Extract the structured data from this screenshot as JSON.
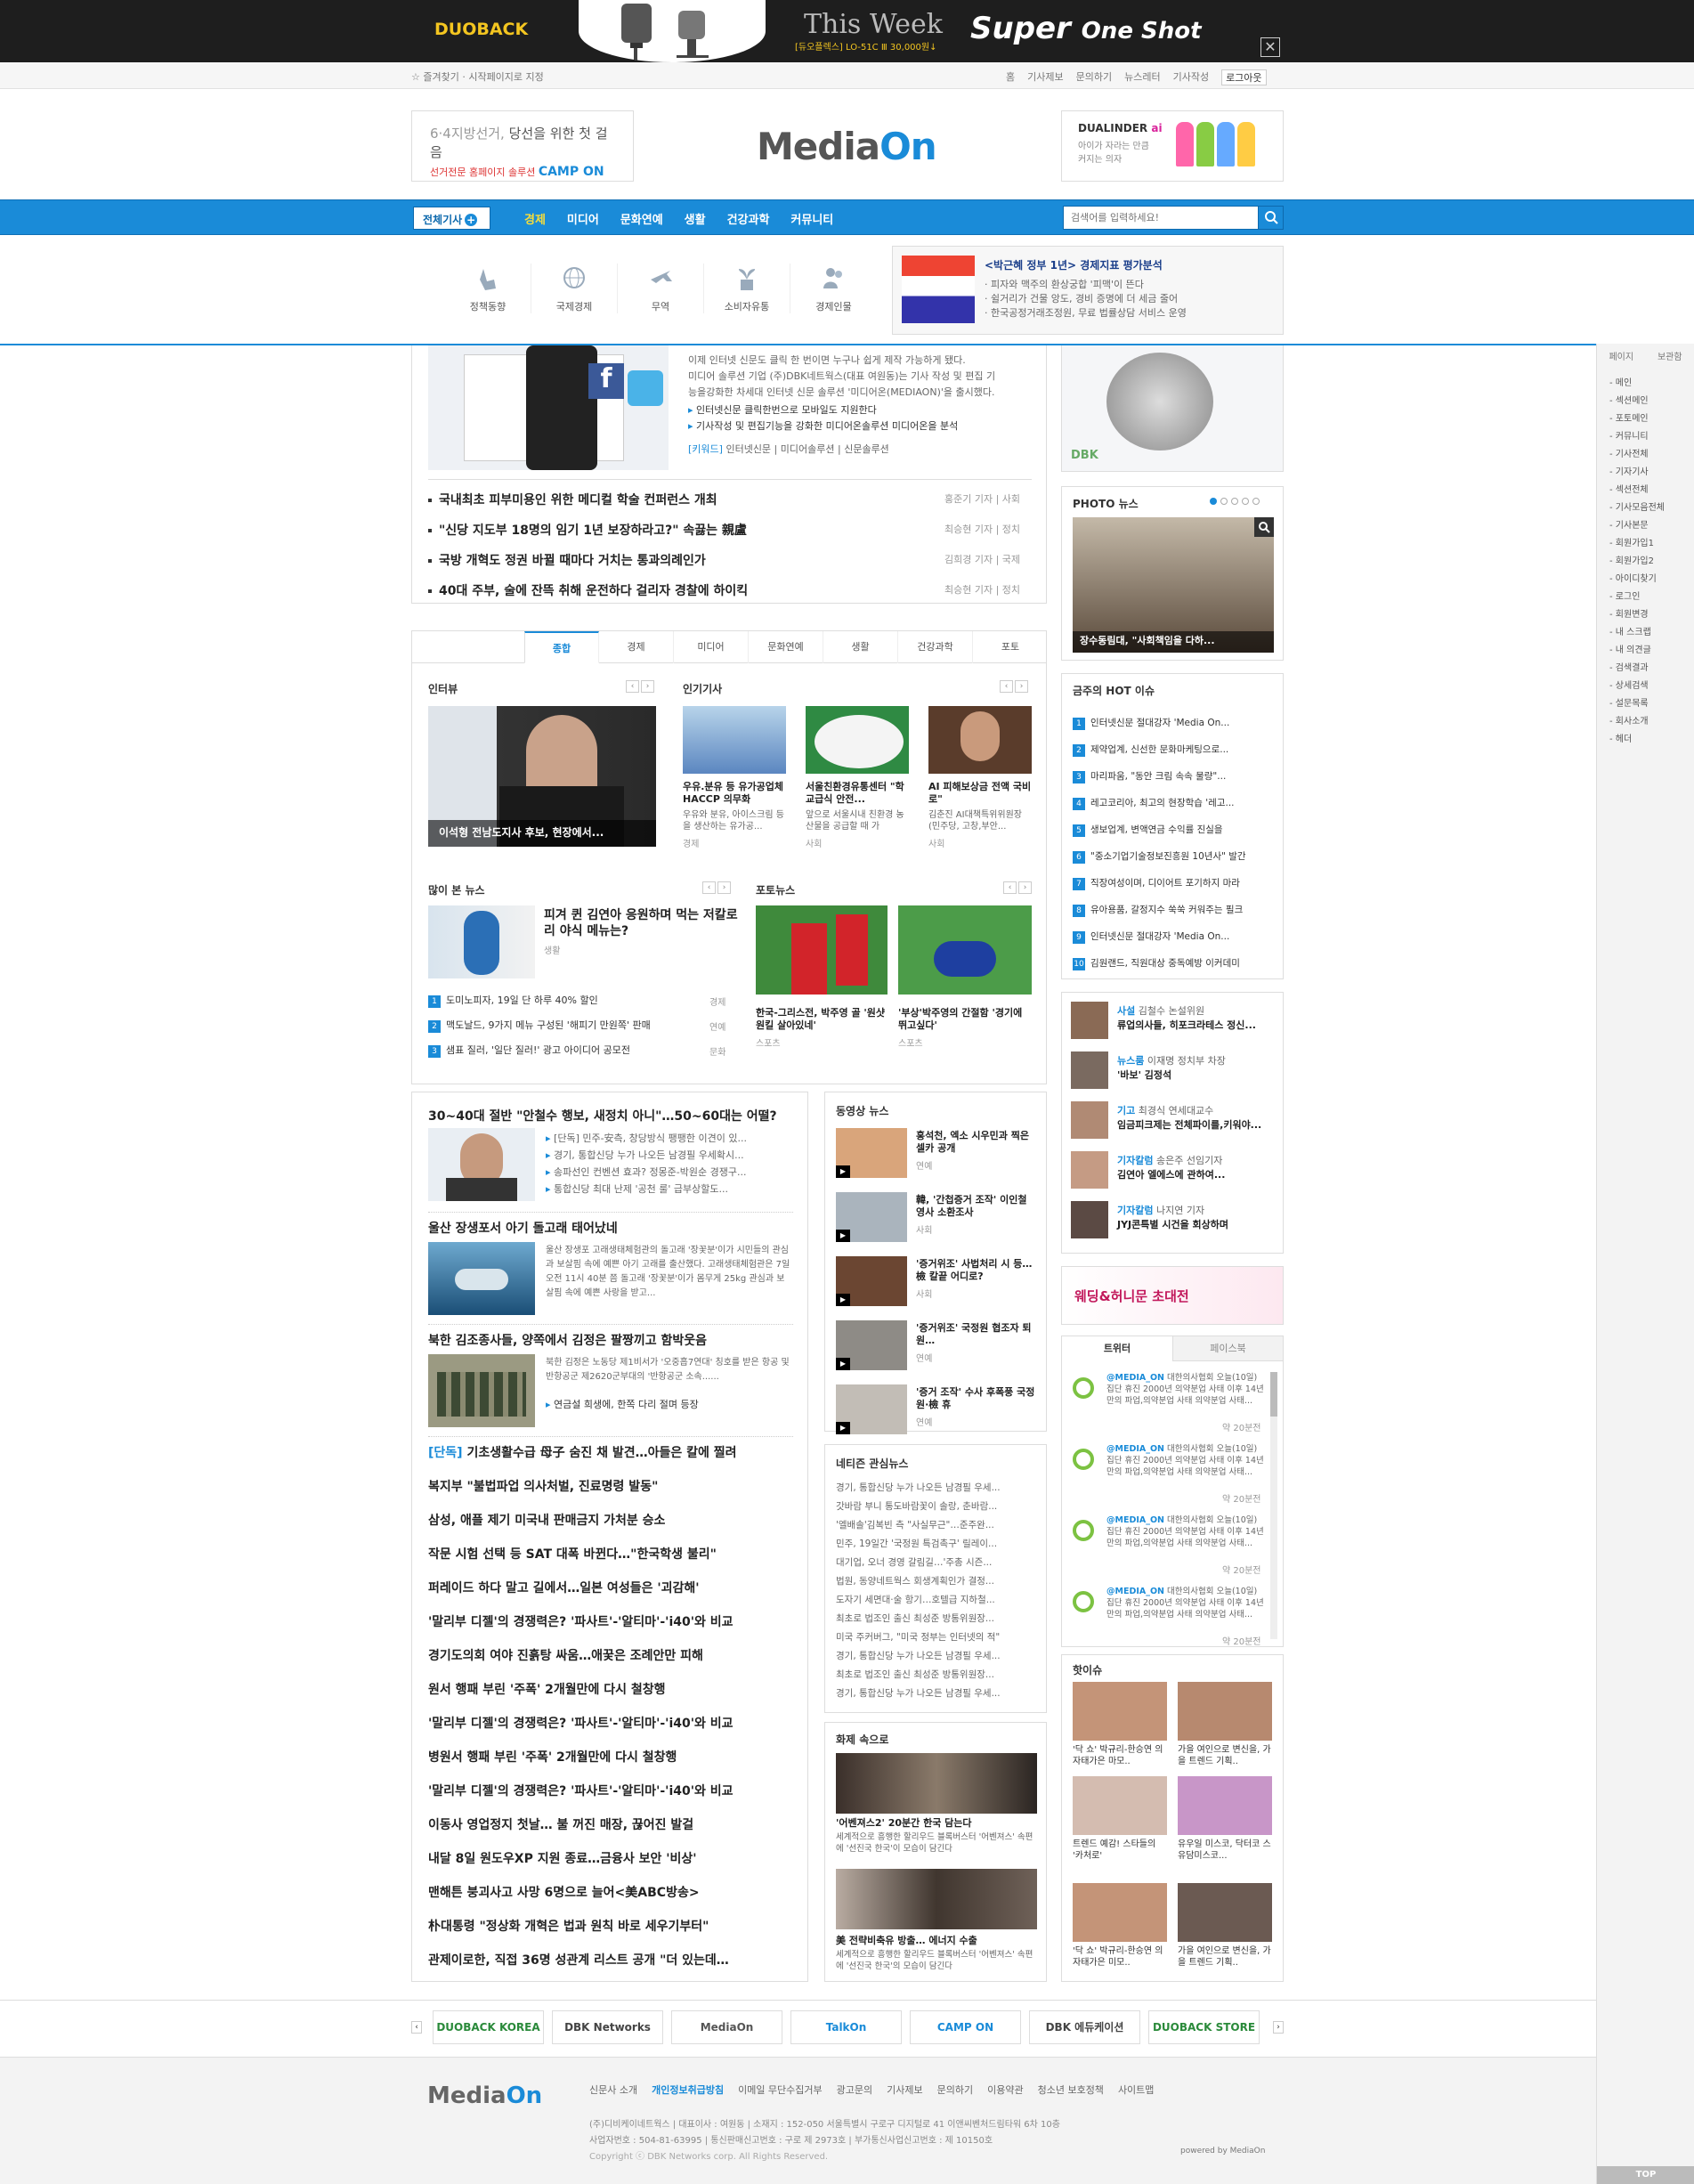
{
  "topad": {
    "brand": "DUOBACK",
    "this_week": "This Week",
    "product": "[듀오플렉스] LO-51C Ⅲ 30,000원↓",
    "super": "Super",
    "oneshot": "One Shot"
  },
  "util": {
    "left": "☆ 즐겨찾기  ·  시작페이지로 지정",
    "items": [
      "홈",
      "기사제보",
      "문의하기",
      "뉴스레터",
      "기사작성"
    ],
    "logout": "로그아웃"
  },
  "header": {
    "banner_left_1": "6·4지방선거,",
    "banner_left_1b": "당선을 위한 첫 걸음",
    "banner_left_2": "선거전문 홈페이지 솔루션",
    "banner_left_brand": "CAMP ON",
    "logo_a": "Media",
    "logo_b": "On",
    "banner_right_brand": "DUALINDER",
    "banner_right_ai": "ai",
    "banner_right_sub": "아이가 자라는 만큼 커지는 의자"
  },
  "nav": {
    "all": "전체기사",
    "items": [
      "경제",
      "미디어",
      "문화연예",
      "생활",
      "건강과학",
      "커뮤니티"
    ],
    "active": "경제",
    "search_placeholder": "검색어를 입력하세요!"
  },
  "subnav": {
    "icons": [
      "정책동향",
      "국제경제",
      "무역",
      "소비자유통",
      "경제인물"
    ],
    "feature_title": "<박근혜 정부 1년> 경제지표 평가분석",
    "feature_items": [
      "· 피자와 맥주의 환상궁합 '피맥'이 뜬다",
      "· 쉴거리가 건물 앙도, 경비 증명에 더 세금 줄어",
      "· 한국공정거래조정원, 무료 법률상담 서비스 운영"
    ]
  },
  "lead": {
    "body": [
      "이제 인터넷 신문도 클릭 한 번이면 누구나 쉽게 제작 가능하게 됐다.",
      "미디어 솔루션 기업 (주)DBK네트웍스(대표 여원동)는 기사 작성 및 편집 기",
      "능을강화한 차세대 인터넷 신문 솔루션 '미디어온(MEDIAON)'을 출시했다."
    ],
    "links": [
      "인터넷신문 클릭한번으로 모바일도 지원한다",
      "기사작성 및 편집기능을 강화한 미디어온솔루션 미디어온을 분석"
    ],
    "keyword_label": "[키워드]",
    "keywords": [
      "인터넷신문",
      "미디어솔루션",
      "신문솔루션"
    ]
  },
  "headlines": [
    {
      "t": "국내최초 피부미용인 위한 메디컬 학술 컨퍼런스 개최",
      "w": "홍준기 기자 | 사회"
    },
    {
      "t": "\"신당 지도부 18명의 임기 1년 보장하라고?\" 속끓는 親盧",
      "w": "최승현 기자 | 정치"
    },
    {
      "t": "국방 개혁도 정권 바뀔 때마다 거치는 통과의례인가",
      "w": "김희경 기자 | 국제"
    },
    {
      "t": "40대 주부, 술에 잔뜩 취해 운전하다 걸리자 경찰에 하이킥",
      "w": "최승현 기자 | 정치"
    }
  ],
  "tabs": [
    "종합",
    "경제",
    "미디어",
    "문화연예",
    "생활",
    "건강과학",
    "포토"
  ],
  "interview": {
    "title": "인터뷰",
    "caption": "이석형 전남도지사 후보, 현장에서..."
  },
  "popular": {
    "title": "인기기사",
    "items": [
      {
        "t": "우유.분유 등 유가공업체 HACCP 의무화",
        "d": "우유와 분유, 아이스크림 등을 생산하는 유가공...",
        "s": "경제"
      },
      {
        "t": "서울친환경유통센터 \"학교급식 안전...",
        "d": "앞으로 서울시내 친환경 농산물을 공급할 때 가",
        "s": "사회"
      },
      {
        "t": "AI 피해보상금 전액 국비로\"",
        "d": "김춘진 AI대책특위위원장(민주당, 고창,부안...",
        "s": "사회"
      }
    ]
  },
  "mostview": {
    "title": "많이 본 뉴스",
    "lead": "피겨 퀸 김연아 응원하며 먹는 저칼로리 야식 메뉴는?",
    "lead_sec": "생활",
    "items": [
      {
        "t": "도미노피자, 19일 단 하루 40% 할인",
        "s": "경제"
      },
      {
        "t": "맥도날드, 9가지 메뉴 구성된 '해피기 만원쪽' 판매",
        "s": "연예"
      },
      {
        "t": "샘표 질러, '일단 질러!' 광고 아이디어 공모전",
        "s": "문화"
      }
    ]
  },
  "photonews": {
    "title": "포토뉴스",
    "items": [
      {
        "t": "한국-그리스전, 박주영 골 '원샷원킬 살아있네'",
        "s": "스포츠"
      },
      {
        "t": "'부상'박주영의 간절함 '경기에 뛰고싶다'",
        "s": "스포츠"
      }
    ]
  },
  "main_stories": [
    {
      "title": "30~40대 절반 \"안철수 행보, 새정치 아니\"…50~60대는 어떨?",
      "subs": [
        "[단독] 민주-安측, 창당방식 팽팽한 이견이 있...",
        "경기, 통합신당 누가 나오든 남경필 우세확시...",
        "송파선인 컨벤션 효과? 정몽준-박원순 경쟁구...",
        "통합신당 최대 난제 '공천 룰' 급부상할도..."
      ]
    },
    {
      "title": "울산 장생포서 아기 돌고래 태어났네",
      "body": "울산 장생포 고래생태체험관의 돌고래 '장꽃분'이가 시민들의 관심과 보살핌 속에 예쁜 아기 고래를 출산했다. 고래생태체험관은 7일 오전 11시 40분 쯤 돌고래 '장꽃분'이가 몸무게 25kg 관심과 보살핌 속에 예쁜 사랑을 받고..."
    },
    {
      "title": "북한 김조종사들, 양쪽에서 김정은 팔짱끼고 함박웃음",
      "body": "북한 김정은 노동당 제1비서가 '오중흡7연대' 칭호를 받은 항공 및 반항공군 제2620군부대의 '반항공군 소속......",
      "link": "연금설 희생에, 한쪽 다리 절며 등장"
    }
  ],
  "more_headlines": [
    {
      "tag": "[단독]",
      "t": "기초생활수급 母子 숨진 채 발견…아들은 칼에 찔려"
    },
    {
      "t": "복지부 \"불법파업 의사처벌, 진료명령 발동\""
    },
    {
      "t": "삼성, 애플 제기 미국내 판매금지 가처분 승소"
    },
    {
      "t": "작문 시험 선택 등 SAT 대폭 바뀐다…\"한국학생 불리\""
    },
    {
      "t": "퍼레이드 하다 말고 길에서…일본 여성들은 '괴감해'"
    },
    {
      "t": "'말리부 디젤'의 경쟁력은? '파사트'-'알티마'-'i40'와 비교"
    },
    {
      "t": "경기도의회 여야 진흙탕 싸움…애꿎은 조례안만 피해"
    },
    {
      "t": "원서 행패 부린 '주폭' 2개월만에 다시 철창행"
    },
    {
      "t": "'말리부 디젤'의 경쟁력은? '파사트'-'알티마'-'i40'와 비교"
    },
    {
      "t": "병원서 행패 부린 '주폭' 2개월만에 다시 철창행"
    },
    {
      "t": "'말리부 디젤'의 경쟁력은? '파사트'-'알티마'-'i40'와 비교"
    },
    {
      "t": "이동사 영업정지 첫날… 불 꺼진 매장, 끊어진 발걸"
    },
    {
      "t": "내달 8일 원도우XP 지원 종료…금융사 보안 '비상'"
    },
    {
      "t": "맨해튼 붕괴사고 사망 6명으로 늘어<美ABC방송>"
    },
    {
      "t": "朴대통령 \"정상화 개혁은 법과 원칙 바로 세우기부터\""
    },
    {
      "t": "관제이로한, 직접 36명 성관계 리스트 공개 \"더 있는데…"
    }
  ],
  "video": {
    "title": "동영상 뉴스",
    "items": [
      {
        "t": "홍석천, 엑소 시우민과 찍은 셀카 공개",
        "s": "연예"
      },
      {
        "t": "韓, '간첩증거 조작' 이인철 영사 소환조사",
        "s": "사회"
      },
      {
        "t": "'증거위조' 사법처리 시 등…檢 칼끝 어디로?",
        "s": "사회"
      },
      {
        "t": "'증거위조' 국정원 협조자 퇴원…",
        "s": "연예"
      },
      {
        "t": "'증거 조작' 수사 후폭풍 국정원·檢 휴",
        "s": "연예"
      }
    ]
  },
  "netizen": {
    "title": "네티즌 관심뉴스",
    "items": [
      "경기, 통합신당 누가 나오든 남경필 우세...",
      "갓바람 부니 통도바람꽃이 솔랑, 춘바람...",
      "'엘배솔'김복빈 측 \"사실무근\"…준주완...",
      "민주, 19일간 '국정원 특검촉구' 릴레이...",
      "대기업, 오너 경영 갈림길…'주총 시즌...",
      "법원, 동양네트웍스 회생계획인가 결정...",
      "도자기 세면대·술 항기…호텔급 지하철...",
      "최초로 법조인 출신 최성준 방통위원장...",
      "미국 주커버그, \"미국 정부는 인터넷의 적\"",
      "경기, 통합신당 누가 나오든 남경필 우세...",
      "최초로 법조인 출신 최성준 방통위원장...",
      "경기, 통합신당 누가 나오든 남경필 우세..."
    ]
  },
  "hotphoto": {
    "title": "화제 속으로",
    "items": [
      {
        "t": "'어벤져스2' 20분간 한국 담는다",
        "d": "세계적으로 흥행한 할리우드 블록버스터 '어벤져스' 속편에 '선진국 한국'이 모습이 담긴다"
      },
      {
        "t": "美 전략비축유 방출… 에너지 수출",
        "d": "세계적으로 흥행한 할리우드 블록버스터 '어벤져스' 속편에 '선진국 한국'의 모습이 담긴다"
      }
    ]
  },
  "right": {
    "ad_brand": "DBK",
    "photo_title": "PHOTO 뉴스",
    "photo_caption": "장수동림대, \"사회책임을 다하...",
    "hot_title": "금주의 HOT 이슈",
    "hot": [
      "인터넷신문 절대강자 'Media On...",
      "제약업계, 신선한 문화마케팅으로...",
      "마리파움, \"동안 크림 속속 물량\"...",
      "레고코리아, 최고의 현장학습 '레고...",
      "생보업계, 변액연금 수익률 진실을",
      "\"중소기업기술정보진흥원 10년사\" 발간",
      "직장여성이며, 디이어트 포기하지 마라",
      "유아용품, 갈정지수 쑥쑥 커워주는 필크",
      "인터넷신문 절대강자 'Media On...",
      "김원랜드, 직원대상 중독예방 이커데미"
    ],
    "columns": [
      {
        "tag": "사설",
        "who": "김철수 논설위원",
        "t": "류업의사들, 히포크라테스 정신..."
      },
      {
        "tag": "뉴스룸",
        "who": "이재명 정치부 차장",
        "t": "'바보' 김정석"
      },
      {
        "tag": "기고",
        "who": "최경식 연세대교수",
        "t": "임금피크제는 전체파이를,키워야..."
      },
      {
        "tag": "기자칼럼",
        "who": "송은주 선임기자",
        "t": "김연아 엘에스에 관하여..."
      },
      {
        "tag": "기자칼럼",
        "who": "나지연 기자",
        "t": "JYJ콘특별 시건을 회상하며"
      }
    ],
    "wed_ad": "웨딩&허니문 초대전",
    "sns_tabs": [
      "트위터",
      "페이스북"
    ],
    "tweets": [
      {
        "h": "@MEDIA_ON",
        "t": "대한의사협회 오늘(10일) 집단 휴진 2000년 의약분업 사태 이후 14년만의 파업,의약분업 사태 의약분업 사태...",
        "time": "약 20분전"
      },
      {
        "h": "@MEDIA_ON",
        "t": "대한의사협회 오늘(10일) 집단 휴진 2000년 의약분업 사태 이후 14년만의 파업,의약분업 사태 의약분업 사태...",
        "time": "약 20분전"
      },
      {
        "h": "@MEDIA_ON",
        "t": "대한의사협회 오늘(10일) 집단 휴진 2000년 의약분업 사태 이후 14년만의 파업,의약분업 사태 의약분업 사태...",
        "time": "약 20분전"
      },
      {
        "h": "@MEDIA_ON",
        "t": "대한의사협회 오늘(10일) 집단 휴진 2000년 의약분업 사태 이후 14년만의 파업,의약분업 사태 의약분업 사태...",
        "time": "약 20분전"
      }
    ],
    "hot_issue": "핫이슈",
    "hot_issue_items": [
      "'닥 쇼' 박규리-한승연 의자태가은 마모..",
      "가을 여인으로 변신을, 가을 트렌드 기획..",
      "트렌드 예감! 스타들의 '카처로'",
      "유우일 미스코, 닥터코 스 유담미스코...",
      "'닥 쇼' 박규리-한승연 의자태가은 미모..",
      "가을 여인으로 변신을, 가을 트렌드 기획.."
    ]
  },
  "sidebar": {
    "tabs": [
      "페이지",
      "보관함"
    ],
    "items": [
      "메인",
      "섹션메인",
      "포토메인",
      "커뮤니티",
      "기사전체",
      "기자기사",
      "섹션전체",
      "기사모음전체",
      "기사본문",
      "회원가입1",
      "회원가입2",
      "아이디찾기",
      "로그인",
      "회원변경",
      "내 스크랩",
      "내 의견글",
      "검색결과",
      "상세검색",
      "설문목록",
      "회사소개",
      "헤더"
    ]
  },
  "partners": [
    "DUOBACK KOREA",
    "DBK Networks",
    "MediaOn",
    "TalkOn",
    "CAMP ON",
    "DBK 에듀케이션",
    "DUOBACK STORE"
  ],
  "footer": {
    "logo_a": "Media",
    "logo_b": "On",
    "links": [
      "신문사 소개",
      "개인정보취급방침",
      "이메일 무단수집거부",
      "광고문의",
      "기사제보",
      "문의하기",
      "이용약관",
      "청소년 보호정책",
      "사이트맵"
    ],
    "info1": "(주)디비케이네트웍스  |  대표이사 : 여원동  |  소재지 : 152-050 서울특별시 구로구 디지털로 41 이앤씨벤처드림타워 6차 10층",
    "info2": "사업자번호 : 504-81-63995  |  통신판매신고번호 : 구로 제 2973호  |  부가통신사업신고번호 : 제 10150호",
    "copy": "Copyright ⓒ DBK Networks corp. All Rights Reserved.",
    "powered": "powered by MediaOn",
    "top": "TOP"
  }
}
